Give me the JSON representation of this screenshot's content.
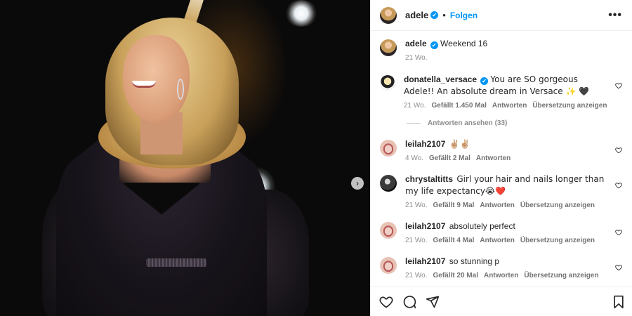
{
  "header": {
    "username": "adele",
    "verified_mark": "✔",
    "separator": "•",
    "follow_label": "Folgen",
    "more_label": "•••"
  },
  "caption": {
    "username": "adele",
    "text": "Weekend 16",
    "time": "21 Wo."
  },
  "comments": [
    {
      "username": "donatella_versace",
      "verified": true,
      "text": "You are SO gorgeous Adele!! An absolute dream in Versace ✨ 🖤",
      "time": "21 Wo.",
      "likes": "Gefällt 1.450 Mal",
      "reply": "Antworten",
      "translate": "Übersetzung anzeigen",
      "view_replies": "Antworten ansehen (33)"
    },
    {
      "username": "leilah2107",
      "text": "✌🏼✌🏼",
      "time": "4 Wo.",
      "likes": "Gefällt 2 Mal",
      "reply": "Antworten"
    },
    {
      "username": "chrystaltitts",
      "text": "Girl your hair and nails longer than my life expectancy😭❤️",
      "time": "21 Wo.",
      "likes": "Gefällt 9 Mal",
      "reply": "Antworten",
      "translate": "Übersetzung anzeigen"
    },
    {
      "username": "leilah2107",
      "text": "absolutely perfect",
      "time": "21 Wo.",
      "likes": "Gefällt 4 Mal",
      "reply": "Antworten",
      "translate": "Übersetzung anzeigen"
    },
    {
      "username": "leilah2107",
      "text": "so stunning p",
      "time": "21 Wo.",
      "likes": "Gefällt 20 Mal",
      "reply": "Antworten",
      "translate": "Übersetzung anzeigen"
    }
  ],
  "media": {
    "next_label": "›"
  },
  "colors": {
    "accent": "#0095f6",
    "text": "#262626",
    "muted": "#8e8e8e"
  },
  "icons": [
    "heart-icon",
    "comment-icon",
    "share-icon",
    "bookmark-icon",
    "more-icon",
    "chevron-right-icon"
  ]
}
